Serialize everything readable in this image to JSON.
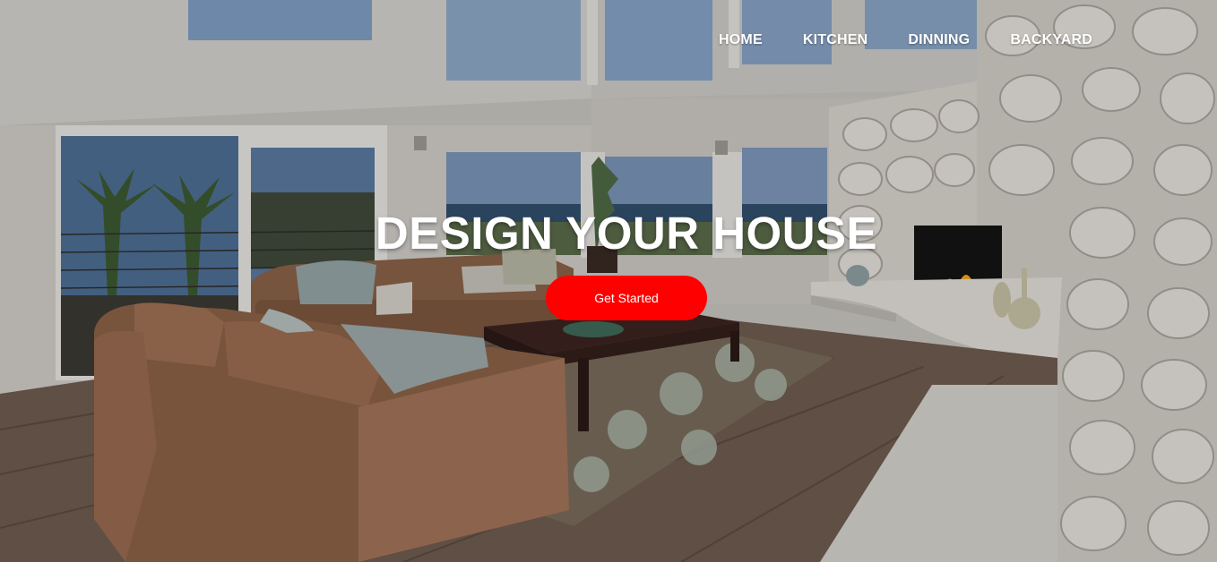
{
  "nav": {
    "items": [
      {
        "label": "HOME"
      },
      {
        "label": "KITCHEN"
      },
      {
        "label": "DINNING"
      },
      {
        "label": "BACKYARD"
      }
    ]
  },
  "hero": {
    "title": "DESIGN YOUR HOUSE",
    "cta_label": "Get Started",
    "cta_color": "#ff0000"
  }
}
